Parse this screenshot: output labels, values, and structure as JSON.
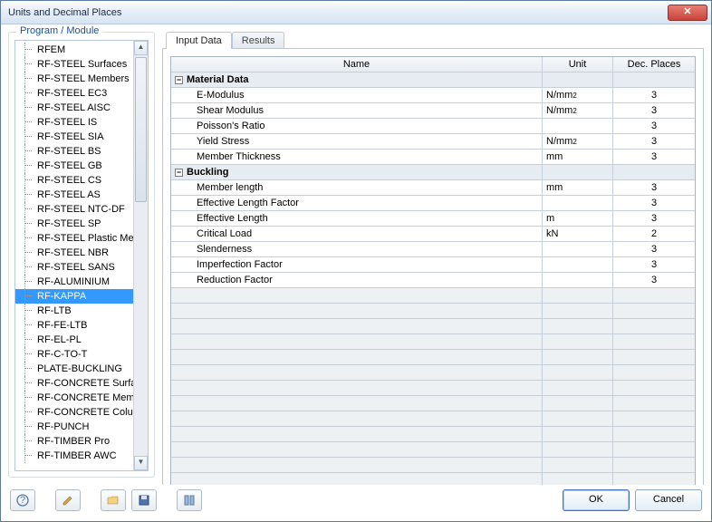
{
  "window": {
    "title": "Units and Decimal Places"
  },
  "sidebar": {
    "title": "Program / Module",
    "selected_index": 17,
    "items": [
      "RFEM",
      "RF-STEEL Surfaces",
      "RF-STEEL Members",
      "RF-STEEL EC3",
      "RF-STEEL AISC",
      "RF-STEEL IS",
      "RF-STEEL SIA",
      "RF-STEEL BS",
      "RF-STEEL GB",
      "RF-STEEL CS",
      "RF-STEEL AS",
      "RF-STEEL NTC-DF",
      "RF-STEEL SP",
      "RF-STEEL Plastic Mem",
      "RF-STEEL NBR",
      "RF-STEEL SANS",
      "RF-ALUMINIUM",
      "RF-KAPPA",
      "RF-LTB",
      "RF-FE-LTB",
      "RF-EL-PL",
      "RF-C-TO-T",
      "PLATE-BUCKLING",
      "RF-CONCRETE Surfac",
      "RF-CONCRETE Membe",
      "RF-CONCRETE Colum",
      "RF-PUNCH",
      "RF-TIMBER Pro",
      "RF-TIMBER AWC"
    ]
  },
  "tabs": {
    "items": [
      "Input Data",
      "Results"
    ],
    "active": 0
  },
  "grid": {
    "headers": {
      "name": "Name",
      "unit": "Unit",
      "dec": "Dec. Places"
    },
    "sections": [
      {
        "label": "Material Data",
        "rows": [
          {
            "name": "E-Modulus",
            "unit": "N/mm²",
            "dec": "3"
          },
          {
            "name": "Shear Modulus",
            "unit": "N/mm²",
            "dec": "3"
          },
          {
            "name": "Poisson's Ratio",
            "unit": "",
            "dec": "3"
          },
          {
            "name": "Yield Stress",
            "unit": "N/mm²",
            "dec": "3"
          },
          {
            "name": "Member Thickness",
            "unit": "mm",
            "dec": "3"
          }
        ]
      },
      {
        "label": "Buckling",
        "rows": [
          {
            "name": "Member length",
            "unit": "mm",
            "dec": "3"
          },
          {
            "name": "Effective Length Factor",
            "unit": "",
            "dec": "3"
          },
          {
            "name": "Effective Length",
            "unit": "m",
            "dec": "3"
          },
          {
            "name": "Critical Load",
            "unit": "kN",
            "dec": "2"
          },
          {
            "name": "Slenderness",
            "unit": "",
            "dec": "3"
          },
          {
            "name": "Imperfection Factor",
            "unit": "",
            "dec": "3"
          },
          {
            "name": "Reduction Factor",
            "unit": "",
            "dec": "3"
          }
        ]
      }
    ],
    "empty_rows": 13
  },
  "buttons": {
    "ok": "OK",
    "cancel": "Cancel"
  },
  "toolbar_icons": [
    "help-icon",
    "edit-icon",
    "open-icon",
    "save-icon",
    "defaults-icon"
  ]
}
